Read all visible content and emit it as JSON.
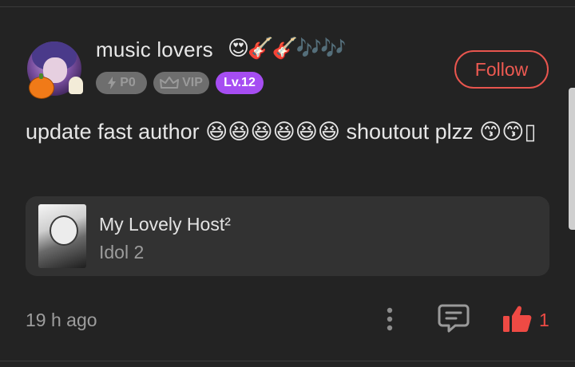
{
  "post": {
    "author": {
      "name": "music lovers",
      "name_emoji": "😍🎸🎸🎶🎶",
      "badges": {
        "p0": "P0",
        "vip": "VIP",
        "level": "Lv.12"
      }
    },
    "follow_label": "Follow",
    "comment": "update fast author 😆😆😆😆😆😆 shoutout plzz 😙😙▯",
    "book": {
      "title": "My Lovely Host²",
      "chapter": "Idol 2"
    },
    "time": "19 h ago",
    "like_count": "1"
  },
  "colors": {
    "background": "#232323",
    "follow_accent": "#e8554e",
    "like_accent": "#ee4a44",
    "level_badge": "#a64df2"
  },
  "icons": [
    "lightning-icon",
    "crown-icon",
    "more-vertical-icon",
    "comment-icon",
    "thumbs-up-icon"
  ]
}
